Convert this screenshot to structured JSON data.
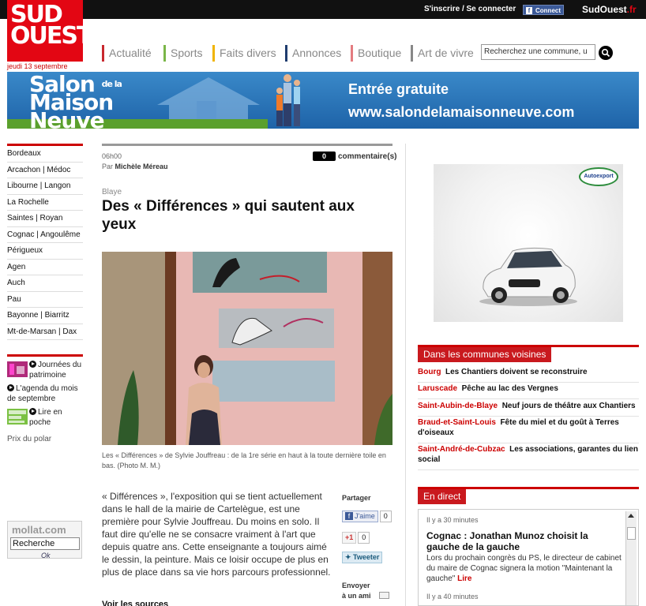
{
  "header": {
    "logo_line1": "SUD",
    "logo_line2": "OUEST",
    "date": "jeudi 13 septembre",
    "inscrire": "S'inscrire / Se connecter",
    "fb_connect": "Connect",
    "brand": "SudOuest",
    "brand_tld": ".fr",
    "search_placeholder": "Recherchez une commune, u"
  },
  "nav": [
    {
      "label": "Actualité",
      "color": "#c8282e"
    },
    {
      "label": "Sports",
      "color": "#7ab648"
    },
    {
      "label": "Faits divers",
      "color": "#f0b400"
    },
    {
      "label": "Annonces",
      "color": "#1f3c6e"
    },
    {
      "label": "Boutique",
      "color": "#e47c80"
    },
    {
      "label": "Art de vivre",
      "color": "#888888"
    }
  ],
  "banner": {
    "salon_1": "Salon",
    "salon_de": "de la",
    "salon_2": "Maison",
    "salon_3": "Neuve",
    "entree": "Entrée gratuite",
    "url": "www.salondelamaisonneuve.com"
  },
  "cities": [
    "Bordeaux",
    "Arcachon  |  Médoc",
    "Libourne  |  Langon",
    "La Rochelle",
    "Saintes  |  Royan",
    "Cognac | Angoulême",
    "Périgueux",
    "Agen",
    "Auch",
    "Pau",
    "Bayonne  |  Biarritz",
    "Mt-de-Marsan  |  Dax"
  ],
  "extras": [
    {
      "text": "Journées du patrimoine"
    },
    {
      "text": "L'agenda du mois de septembre"
    },
    {
      "text": "Lire en poche"
    }
  ],
  "prix_polar": "Prix du polar",
  "mollat": {
    "logo": "mollat.com",
    "value": "Recherche",
    "ok": "Ok"
  },
  "article": {
    "time": "06h00",
    "par": "Par",
    "author": "Michèle Méreau",
    "comments_count": "0",
    "comments_label": "commentaire(s)",
    "rubrique": "Blaye",
    "title": "Des « Différences » qui sautent aux yeux",
    "caption": "Les « Différences » de Sylvie Jouffreau : de la 1re série en haut à la toute dernière toile en bas. (Photo M. M.)",
    "body": "« Différences », l'exposition qui se tient actuellement dans le hall de la mairie de Cartelègue, est une première pour Sylvie Jouffreau. Du moins en solo. Il faut dire qu'elle ne se consacre vraiment à l'art que depuis quatre ans. Cette enseignante a toujours aimé le dessin, la peinture. Mais ce loisir occupe de plus en plus de place dans sa vie hors parcours professionnel.",
    "voir": "Voir les sources"
  },
  "share": {
    "title": "Partager",
    "fb_label": "J'aime",
    "fb_count": "0",
    "gp_label": "+1",
    "gp_count": "0",
    "tw_label": "Tweeter",
    "envoyer_1": "Envoyer",
    "envoyer_2": "à un ami"
  },
  "ad": {
    "brand": "Autoexport"
  },
  "voisines": {
    "title": "Dans les communes voisines",
    "items": [
      {
        "loc": "Bourg",
        "title": "Les Chantiers doivent se reconstruire"
      },
      {
        "loc": "Laruscade",
        "title": "Pêche au lac des Vergnes"
      },
      {
        "loc": "Saint-Aubin-de-Blaye",
        "title": "Neuf jours de théâtre aux Chantiers"
      },
      {
        "loc": "Braud-et-Saint-Louis",
        "title": "Fête du miel et du goût à Terres d'oiseaux"
      },
      {
        "loc": "Saint-André-de-Cubzac",
        "title": "Les associations, garantes du lien social"
      }
    ]
  },
  "direct": {
    "title": "En direct",
    "time1": "Il y a 30 minutes",
    "headline": "Cognac : Jonathan Munoz choisit la gauche de la gauche",
    "text": "Lors du prochain congrès du PS, le directeur de cabinet du maire de Cognac signera la motion \"Maintenant la gauche\"",
    "lire": "Lire",
    "time2": "Il y a 40 minutes"
  }
}
